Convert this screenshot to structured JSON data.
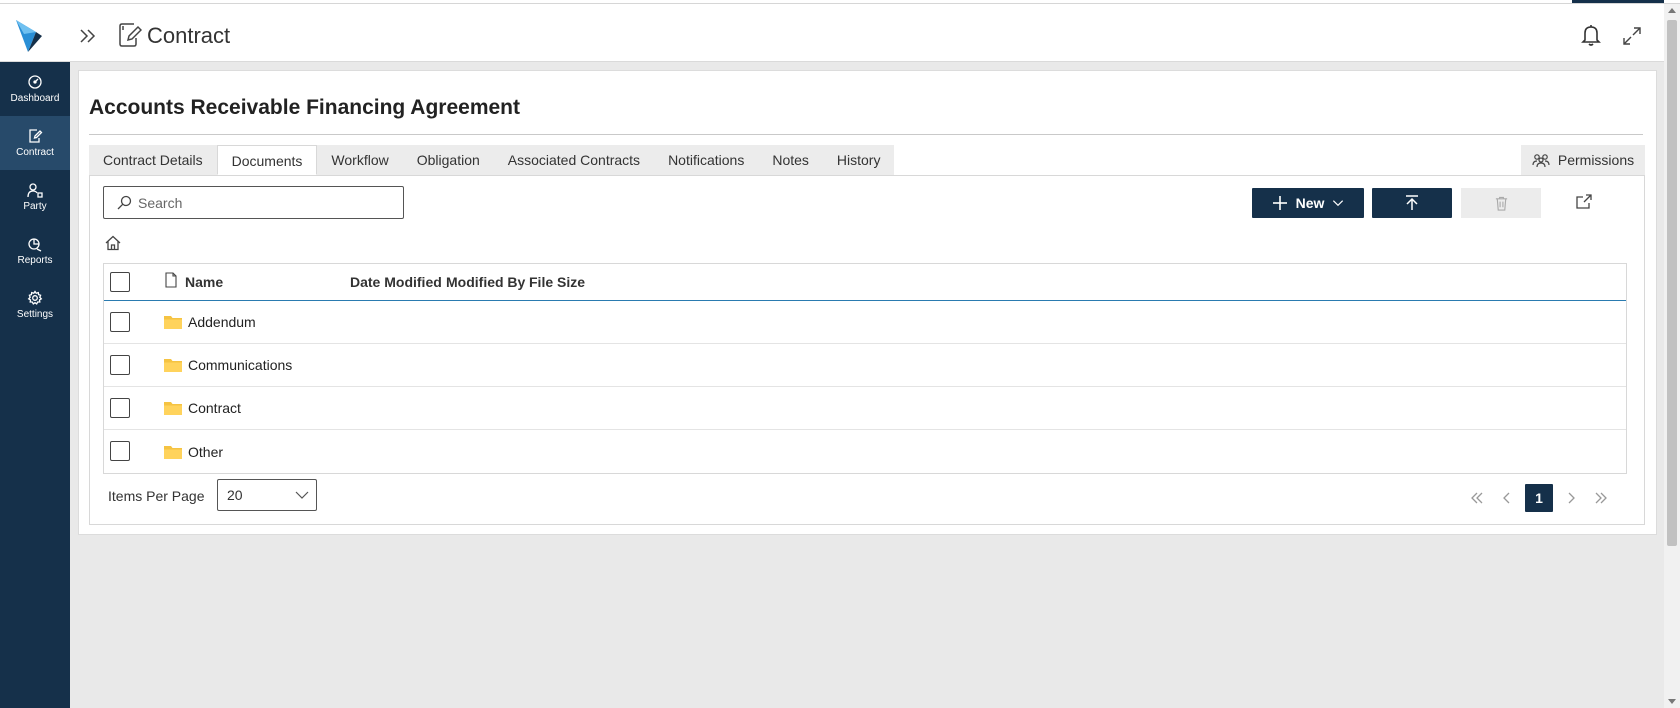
{
  "header": {
    "title": "Contract"
  },
  "sidebar": {
    "items": [
      {
        "label": "Dashboard",
        "icon": "dashboard-icon"
      },
      {
        "label": "Contract",
        "icon": "contract-icon",
        "active": true
      },
      {
        "label": "Party",
        "icon": "party-icon"
      },
      {
        "label": "Reports",
        "icon": "reports-icon"
      },
      {
        "label": "Settings",
        "icon": "gear-icon"
      }
    ]
  },
  "page": {
    "title": "Accounts Receivable Financing Agreement"
  },
  "tabs": [
    {
      "label": "Contract Details"
    },
    {
      "label": "Documents",
      "active": true
    },
    {
      "label": "Workflow"
    },
    {
      "label": "Obligation"
    },
    {
      "label": "Associated Contracts"
    },
    {
      "label": "Notifications"
    },
    {
      "label": "Notes"
    },
    {
      "label": "History"
    }
  ],
  "permissions": {
    "label": "Permissions"
  },
  "toolbar": {
    "search_placeholder": "Search",
    "new_label": "New"
  },
  "grid": {
    "columns": [
      "Name",
      "Date Modified",
      "Modified By",
      "File Size"
    ],
    "rows": [
      {
        "name": "Addendum",
        "type": "folder"
      },
      {
        "name": "Communications",
        "type": "folder"
      },
      {
        "name": "Contract",
        "type": "folder"
      },
      {
        "name": "Other",
        "type": "folder"
      }
    ]
  },
  "footer": {
    "items_per_page_label": "Items Per Page",
    "items_per_page_value": "20",
    "current_page": "1"
  },
  "colors": {
    "brand_navy": "#15304a",
    "sidebar_active": "#274a6a",
    "folder_yellow": "#f5c342",
    "grid_header_rule": "#2a7bb0"
  }
}
